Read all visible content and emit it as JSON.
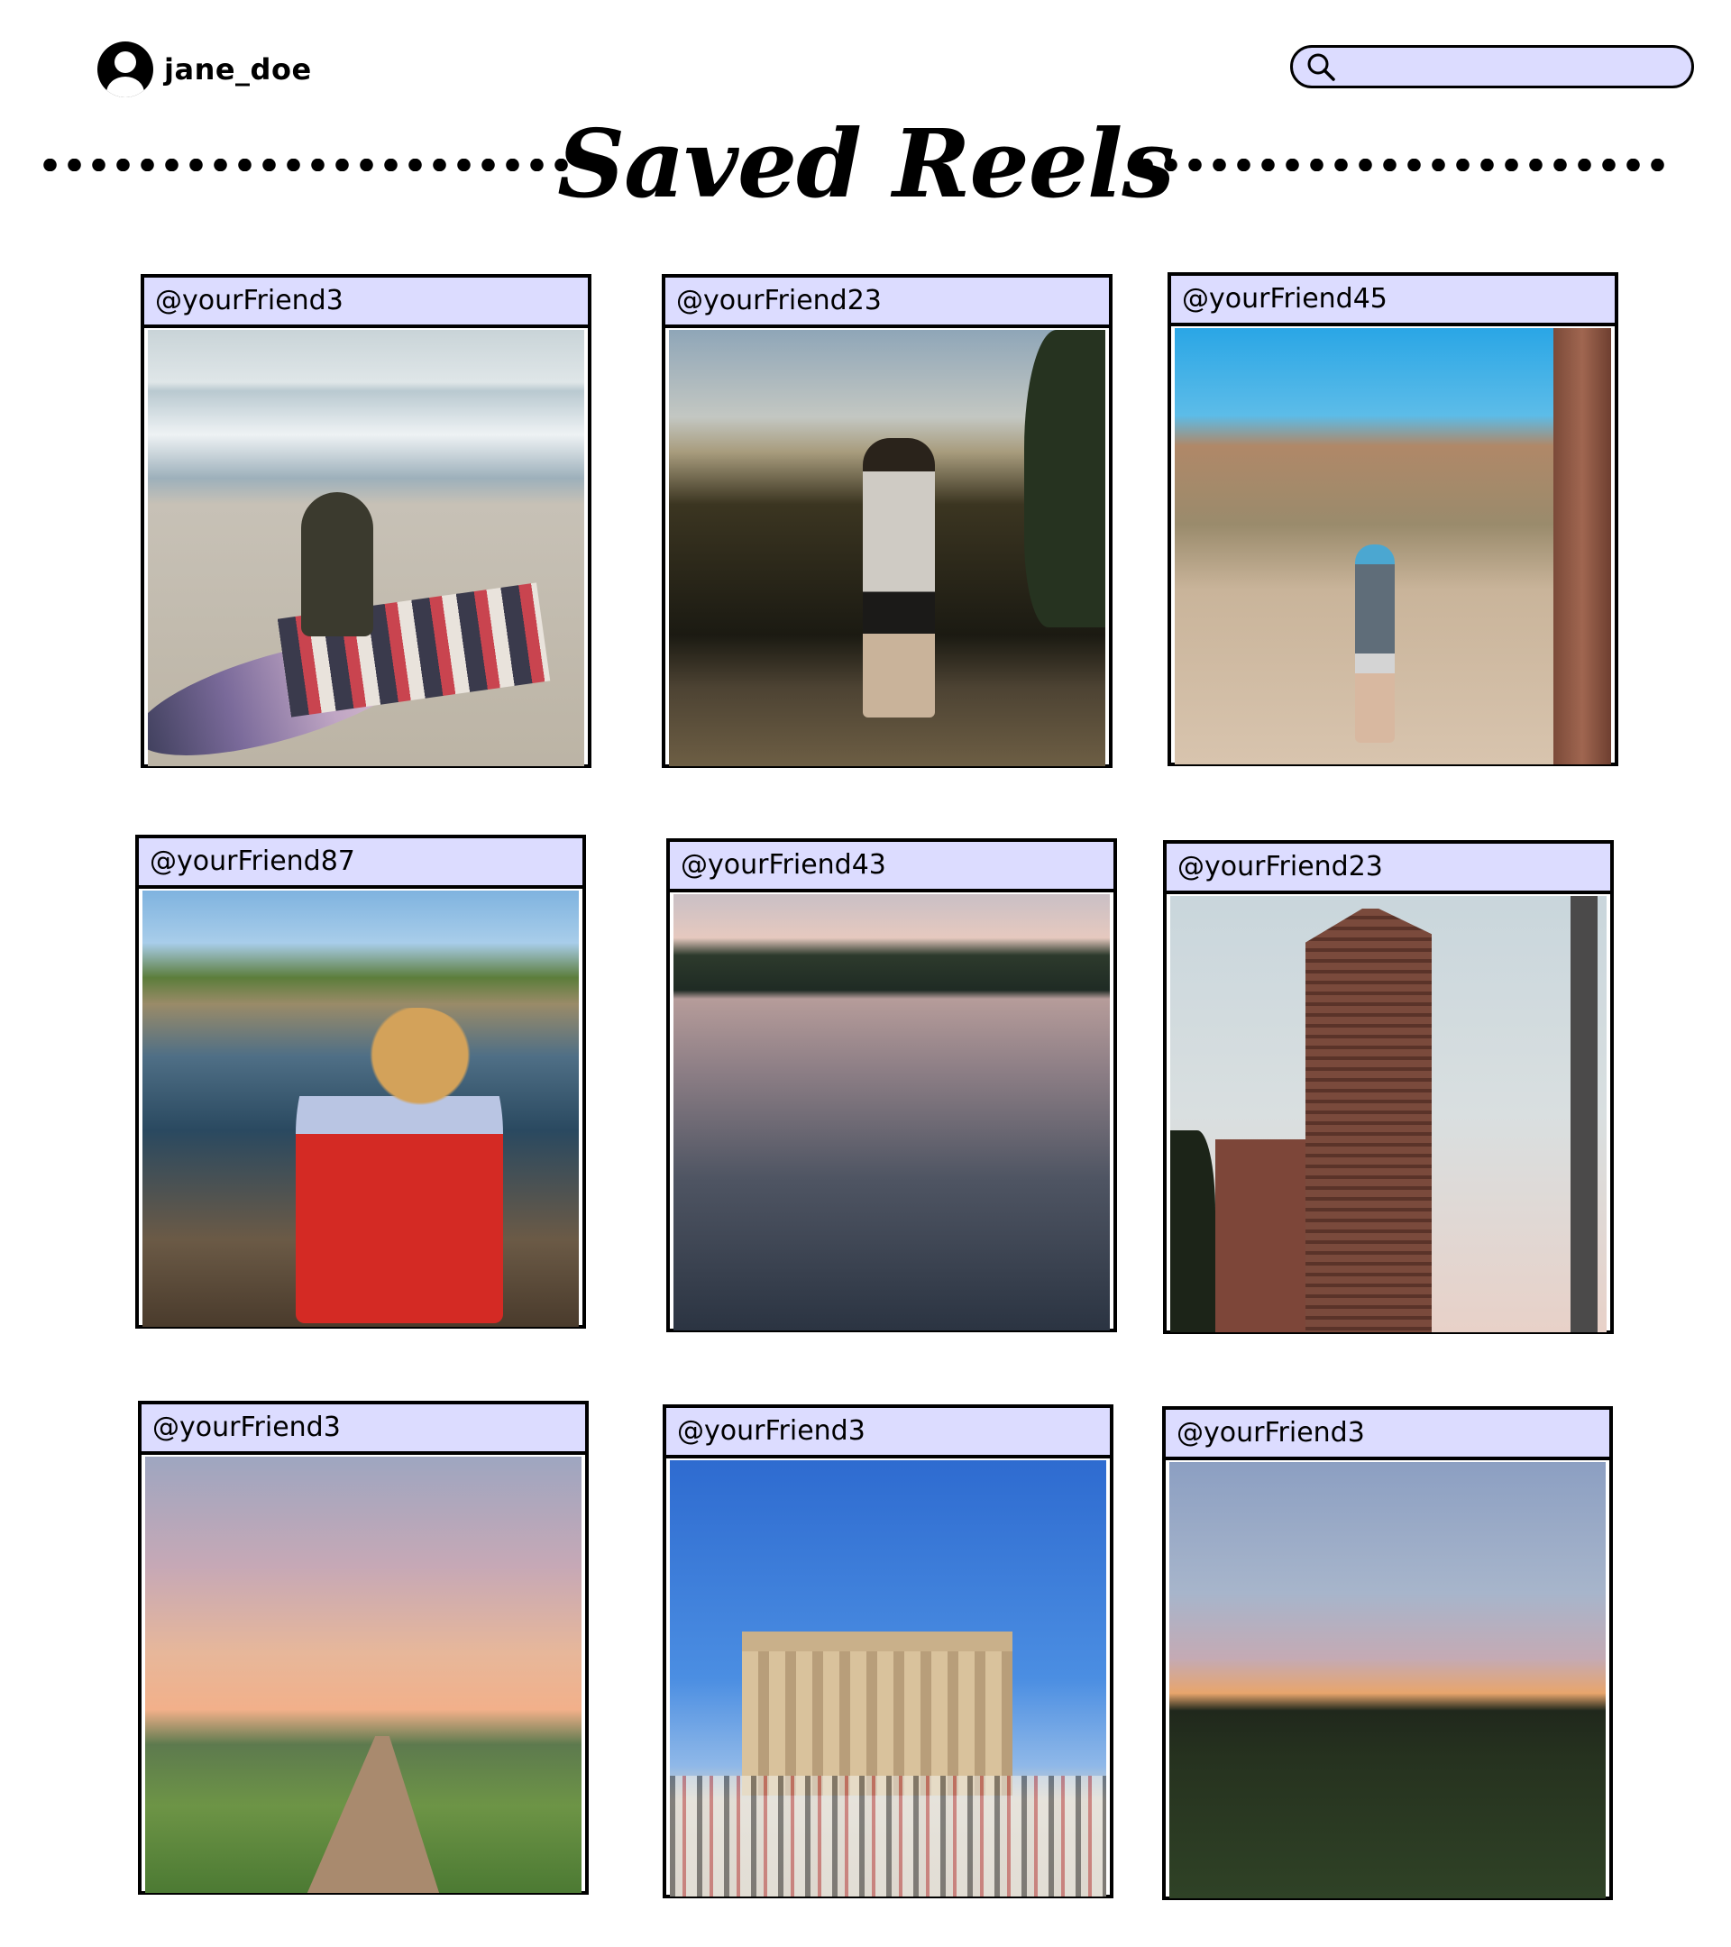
{
  "header": {
    "username": "jane_doe",
    "search": {
      "value": "",
      "placeholder": ""
    }
  },
  "title": "Saved Reels",
  "reels": [
    {
      "user": "@yourFriend3",
      "scene": "beach"
    },
    {
      "user": "@yourFriend23",
      "scene": "overlook"
    },
    {
      "user": "@yourFriend45",
      "scene": "desert"
    },
    {
      "user": "@yourFriend87",
      "scene": "coast"
    },
    {
      "user": "@yourFriend43",
      "scene": "lake"
    },
    {
      "user": "@yourFriend23",
      "scene": "city"
    },
    {
      "user": "@yourFriend3",
      "scene": "resort"
    },
    {
      "user": "@yourFriend3",
      "scene": "parthenon"
    },
    {
      "user": "@yourFriend3",
      "scene": "field"
    }
  ],
  "colors": {
    "label_bg": "#dcdcff",
    "border": "#000000",
    "search_bg": "#dcdcff"
  }
}
